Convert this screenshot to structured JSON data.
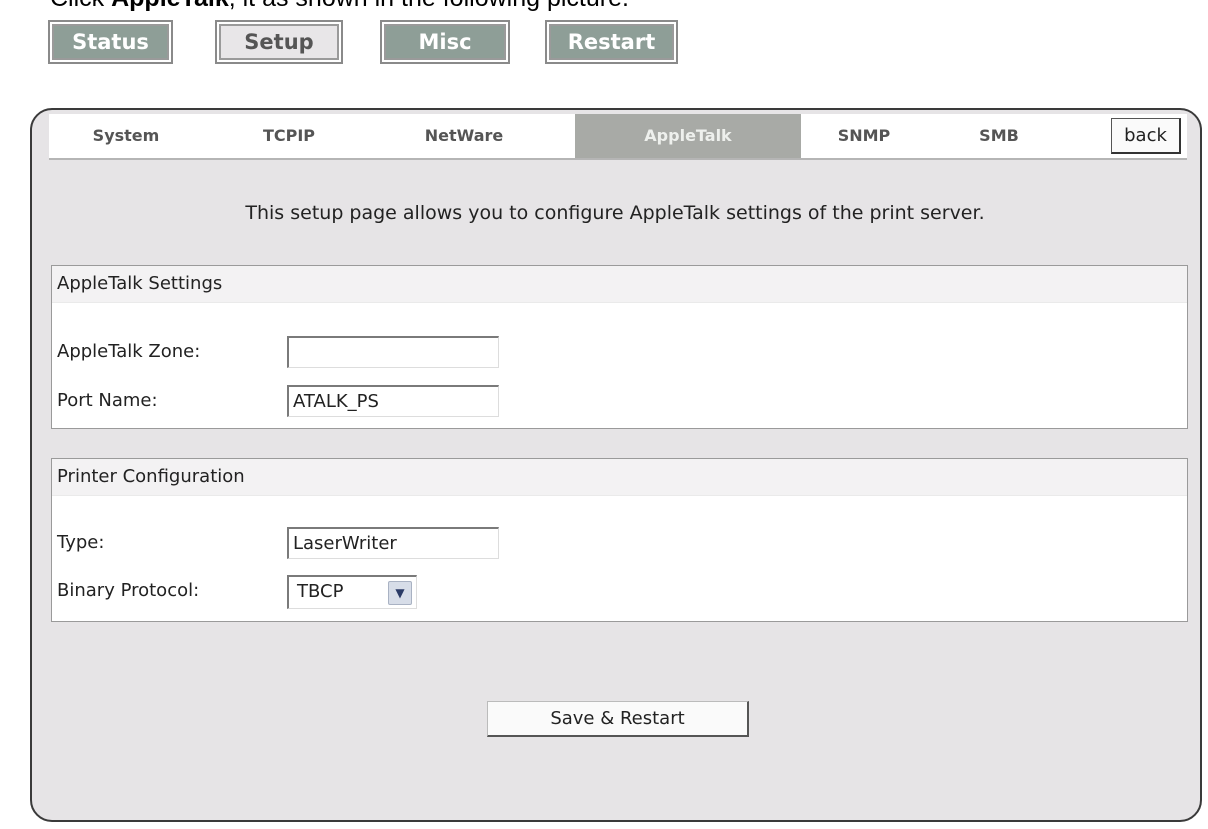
{
  "caption": {
    "prefix": "Click ",
    "bold": "AppleTalk",
    "suffix": ", it as shown in the following picture."
  },
  "topnav": {
    "items": [
      {
        "label": "Status",
        "active": false
      },
      {
        "label": "Setup",
        "active": true
      },
      {
        "label": "Misc",
        "active": false
      },
      {
        "label": "Restart",
        "active": false
      }
    ]
  },
  "tabs": {
    "items": [
      {
        "label": "System",
        "active": false
      },
      {
        "label": "TCPIP",
        "active": false
      },
      {
        "label": "NetWare",
        "active": false
      },
      {
        "label": "AppleTalk",
        "active": true
      },
      {
        "label": "SNMP",
        "active": false
      },
      {
        "label": "SMB",
        "active": false
      }
    ],
    "back_label": "back"
  },
  "intro": "This setup page allows you to configure AppleTalk settings of the print server.",
  "appletalk_settings": {
    "title": "AppleTalk Settings",
    "zone_label": "AppleTalk Zone:",
    "zone_value": "",
    "port_label": "Port Name:",
    "port_value": "ATALK_PS"
  },
  "printer_config": {
    "title": "Printer Configuration",
    "type_label": "Type:",
    "type_value": "LaserWriter",
    "binary_label": "Binary Protocol:",
    "binary_value": "TBCP"
  },
  "save_label": "Save & Restart",
  "colors": {
    "nav_inactive": "#8e9e97",
    "nav_active": "#e8e6e8",
    "panel_bg": "#e6e4e6",
    "tab_active": "#a8aaa6"
  }
}
